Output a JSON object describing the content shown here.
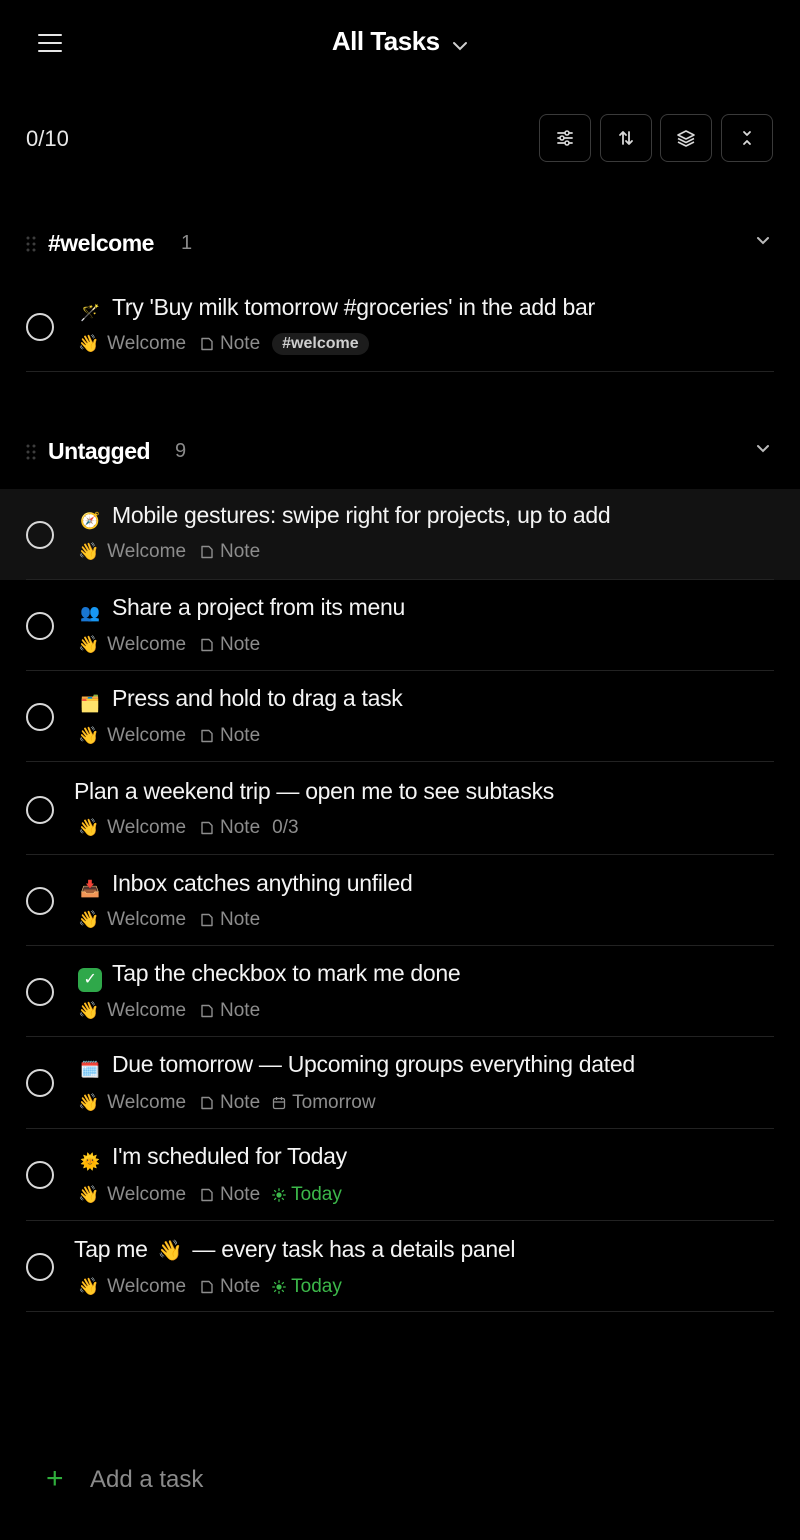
{
  "header": {
    "title": "All Tasks",
    "completed_count": "0/10"
  },
  "groups": [
    {
      "title": "#welcome",
      "count": "1"
    },
    {
      "title": "Untagged",
      "count": "9"
    }
  ],
  "tasks": [
    {
      "title": "Try 'Buy milk tomorrow #groceries' in the add bar",
      "project": "Welcome",
      "type": "Note",
      "tag": "#welcome",
      "icon": "magic-wand-icon"
    },
    {
      "title": "Mobile gestures: swipe right for projects, up to add",
      "project": "Welcome",
      "type": "Note",
      "icon": "compass-icon"
    },
    {
      "title": "Share a project from its menu",
      "project": "Welcome",
      "type": "Note",
      "icon": "people-icon"
    },
    {
      "title": "Press and hold to drag a task",
      "project": "Welcome",
      "type": "Note",
      "icon": "folder-icon"
    },
    {
      "title": "Plan a weekend trip — open me to see subtasks",
      "project": "Welcome",
      "type": "Note",
      "subtasks": "0/3"
    },
    {
      "title": "Inbox catches anything unfiled",
      "project": "Welcome",
      "type": "Note",
      "icon": "inbox-tray-icon"
    },
    {
      "title": "Tap the checkbox to mark me done",
      "project": "Welcome",
      "type": "Note",
      "icon": "check-mark-icon"
    },
    {
      "title": "Due tomorrow — Upcoming groups everything dated",
      "project": "Welcome",
      "type": "Note",
      "date": "Tomorrow",
      "icon": "calendar-icon"
    },
    {
      "title": "I'm scheduled for Today",
      "project": "Welcome",
      "type": "Note",
      "date": "Today",
      "icon": "sun-icon"
    },
    {
      "title_part1": "Tap me",
      "title_part2": "— every task has a details panel",
      "project": "Welcome",
      "type": "Note",
      "date": "Today"
    }
  ],
  "add_task": {
    "label": "Add a task"
  },
  "colors": {
    "background": "#000000",
    "accent_green": "#2fae3c",
    "today_green": "#3cb84a",
    "muted": "#8d8d8d"
  }
}
